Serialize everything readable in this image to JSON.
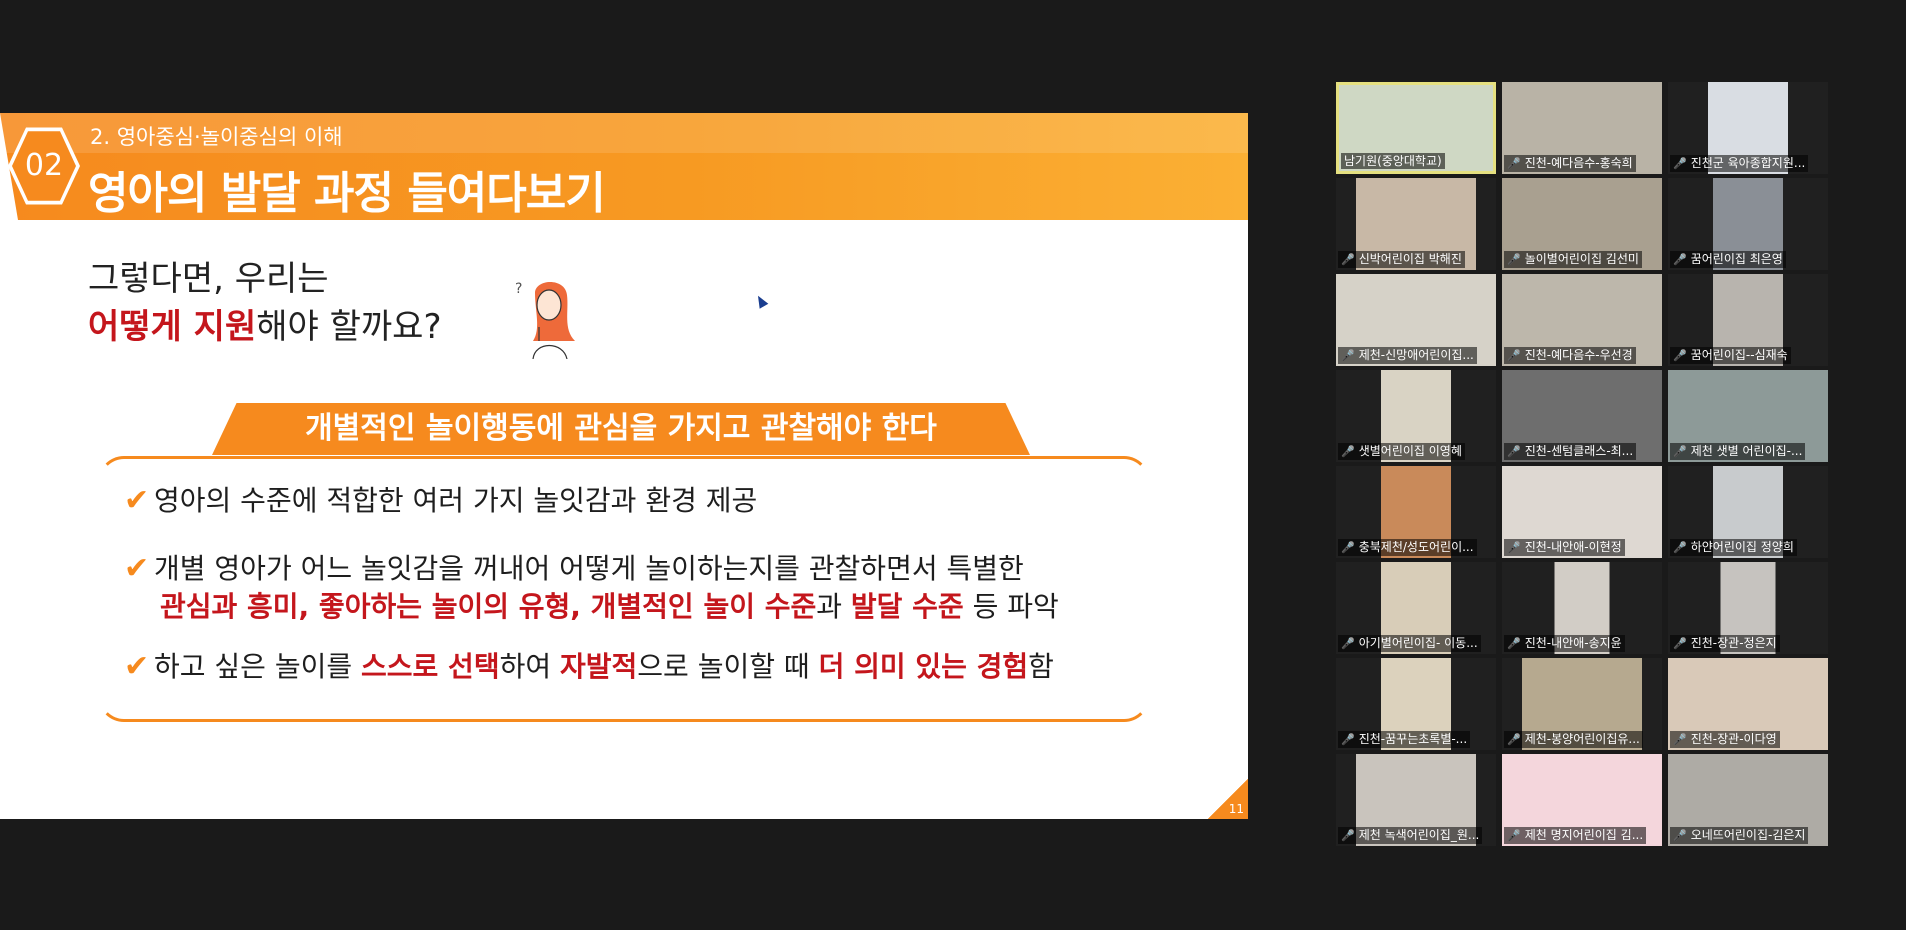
{
  "slide": {
    "section_number": "02",
    "subtitle": "2. 영아중심·놀이중심의 이해",
    "title": "영아의 발달 과정 들여다보기",
    "question_line1": "그렇다면, 우리는",
    "question_red": "어떻게 지원",
    "question_rest": "해야 할까요?",
    "tab_label": "개별적인 놀이행동에 관심을 가지고 관찰해야 한다",
    "bullet1": "영아의 수준에 적합한 여러 가지 놀잇감과 환경 제공",
    "bullet2_line1": "개별 영아가 어느 놀잇감을 꺼내어 어떻게 놀이하는지를 관찰하면서 특별한",
    "bullet2_red1": "관심과 흥미, 좋아하는 놀이의 유형, 개별적인 놀이 수준",
    "bullet2_mid": "과 ",
    "bullet2_red2": "발달 수준",
    "bullet2_end": " 등 파악",
    "bullet3_a": "하고 싶은 놀이를 ",
    "bullet3_red1": "스스로 선택",
    "bullet3_b": "하여 ",
    "bullet3_red2": "자발적",
    "bullet3_c": "으로 놀이할 때 ",
    "bullet3_red3": "더 의미 있는 경험",
    "bullet3_d": "함",
    "page_number": "11",
    "accent_color": "#f68a1e",
    "highlight_color": "#c4161c"
  },
  "participants": [
    {
      "name": "남기원(중앙대학교)",
      "muted": false,
      "active": true,
      "bg": "#cfd8c4",
      "w": 160
    },
    {
      "name": "진천-예다음수-홍숙희",
      "muted": true,
      "bg": "#b9b3a6",
      "w": 160
    },
    {
      "name": "진천군 육아종합지원...",
      "muted": true,
      "bg": "#d9dde3",
      "w": 80
    },
    {
      "name": "신박어린이집 박해진",
      "muted": true,
      "bg": "#c8b8a6",
      "w": 120
    },
    {
      "name": "놀이별어린이집 김선미",
      "muted": true,
      "bg": "#a9a090",
      "w": 160
    },
    {
      "name": "꿈어린이집 최은영",
      "muted": true,
      "bg": "#8a8f96",
      "w": 70
    },
    {
      "name": "제천-신망애어린이집...",
      "muted": true,
      "bg": "#d6d2c8",
      "w": 160
    },
    {
      "name": "진천-예다음수-우선경",
      "muted": true,
      "bg": "#bdb7ab",
      "w": 160
    },
    {
      "name": "꿈어린이집--심재숙",
      "muted": true,
      "bg": "#b8b4ae",
      "w": 70
    },
    {
      "name": "샛별어린이집 이영혜",
      "muted": true,
      "bg": "#d9d3c4",
      "w": 70
    },
    {
      "name": "진천-센텀클래스-최...",
      "muted": true,
      "bg": "#6e6e6e",
      "w": 160
    },
    {
      "name": "제천 샛별 어린이집-...",
      "muted": true,
      "bg": "#8d9a98",
      "w": 160
    },
    {
      "name": "충북제천/성도어린이...",
      "muted": true,
      "bg": "#c98a5a",
      "w": 70
    },
    {
      "name": "진천-내안애-이현정",
      "muted": true,
      "bg": "#ded8d2",
      "w": 160
    },
    {
      "name": "하얀어린이집 정양희",
      "muted": true,
      "bg": "#c8cbcd",
      "w": 70
    },
    {
      "name": "아기별어린이집- 이동...",
      "muted": true,
      "bg": "#d8cdb8",
      "w": 70
    },
    {
      "name": "진천-내안애-송지윤",
      "muted": true,
      "bg": "#d2cdc6",
      "w": 55
    },
    {
      "name": "진천-장관-정은지",
      "muted": true,
      "bg": "#c6c3bf",
      "w": 55
    },
    {
      "name": "진천-꿈꾸는초록별-...",
      "muted": true,
      "bg": "#dcd2bd",
      "w": 70
    },
    {
      "name": "제천-봉양어린이집유...",
      "muted": true,
      "bg": "#b6a98f",
      "w": 120
    },
    {
      "name": "진천-장관-이다영",
      "muted": true,
      "bg": "#d9c9b8",
      "w": 160
    },
    {
      "name": "제천 녹색어린이집_원...",
      "muted": true,
      "bg": "#c9c4bd",
      "w": 120
    },
    {
      "name": "제천 명지어린이집 김...",
      "muted": true,
      "bg": "#f4d6dc",
      "w": 160
    },
    {
      "name": "오네뜨어린이집-김은지",
      "muted": true,
      "bg": "#aeaba5",
      "w": 160
    }
  ]
}
